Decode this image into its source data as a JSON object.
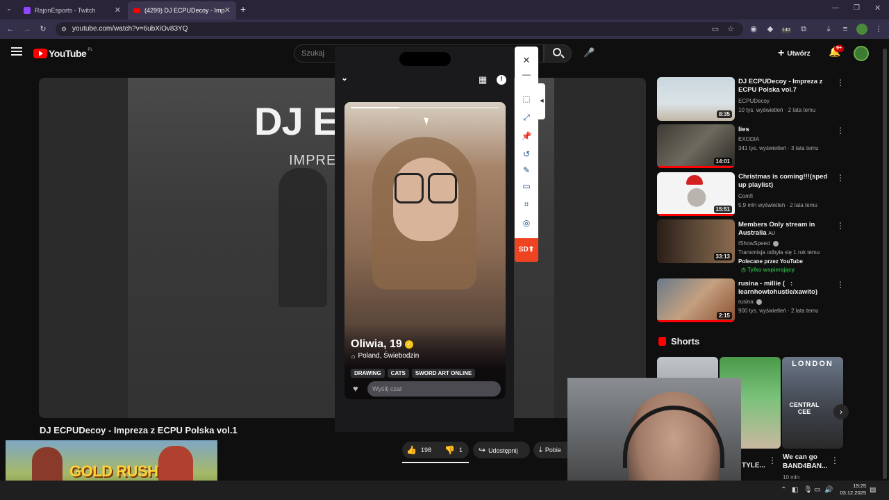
{
  "browser": {
    "tabs": [
      {
        "label": "RajonEsports - Twitch",
        "active": false
      },
      {
        "label": "(4299) DJ ECPUDecoy - Imp",
        "active": true
      }
    ],
    "url": "youtube.com/watch?v=6ubXiOv83YQ",
    "extension_badge": "140"
  },
  "youtube": {
    "logo": "YouTube",
    "region": "PL",
    "search_placeholder": "Szukaj",
    "create_label": "Utwórz",
    "notif_badge": "9+"
  },
  "video": {
    "overlay_title": "DJ ECI",
    "overlay_sub": "IMPRE",
    "title": "DJ ECPUDecoy - Impreza z ECPU Polska vol.1",
    "likes": "198",
    "dislikes": "1",
    "share_label": "Udostępnij",
    "download_label": "Pobie"
  },
  "dating_app": {
    "name_age": "Oliwia, 19",
    "location": "Poland, Świebodzin",
    "tags": [
      "DRAWING",
      "CATS",
      "SWORD ART ONLINE"
    ],
    "chat_placeholder": "Wyślij czat"
  },
  "snip_toolbar": {
    "quality_label": "SD"
  },
  "recommendations": [
    {
      "title": "DJ ECPUDecoy - Impreza z ECPU Polska vol.7",
      "channel": "ECPUDecoy",
      "meta": "10 tys. wyświetleń · 2 lata temu",
      "duration": "8:35"
    },
    {
      "title": "lies",
      "channel": "EXODIA",
      "meta": "341 tys. wyświetleń · 3 lata temu",
      "duration": "14:01"
    },
    {
      "title": "Christmas is coming!!!(sped up playlist)",
      "channel": "Comfi",
      "meta": "5,9 mln wyświetleń · 2 lata temu",
      "duration": "15:51"
    },
    {
      "title": "Members Only stream in Australia",
      "title_badge": "AU",
      "channel": "IShowSpeed",
      "meta": "Transmisja odbyła się 1 rok temu",
      "extra": "Polecane przez YouTube",
      "members": "Tylko wspierający",
      "duration": "33:13"
    },
    {
      "title": "rusina - millie (   : learnhowtohustle/xawito)",
      "channel": "rusina",
      "meta": "900 tys. wyświetleń · 2 lata temu",
      "duration": "2:15"
    }
  ],
  "shorts": {
    "heading": "Shorts",
    "items": [
      {
        "title": "",
        "views": ""
      },
      {
        "title": "TYLE...",
        "views": ""
      },
      {
        "title": "We can go BAND4BAN...",
        "views": "10 mln",
        "thumb_text_1": "LONDON",
        "thumb_text_2": "CENTRAL CEE"
      }
    ]
  },
  "banner": {
    "text": "GOLD RUSH"
  },
  "taskbar": {
    "time": "19:25",
    "date": "03.12.2025"
  },
  "colors": {
    "youtube_red": "#ff0000",
    "verified_yellow": "#f5c518",
    "accent_green": "#3ea6ff"
  }
}
